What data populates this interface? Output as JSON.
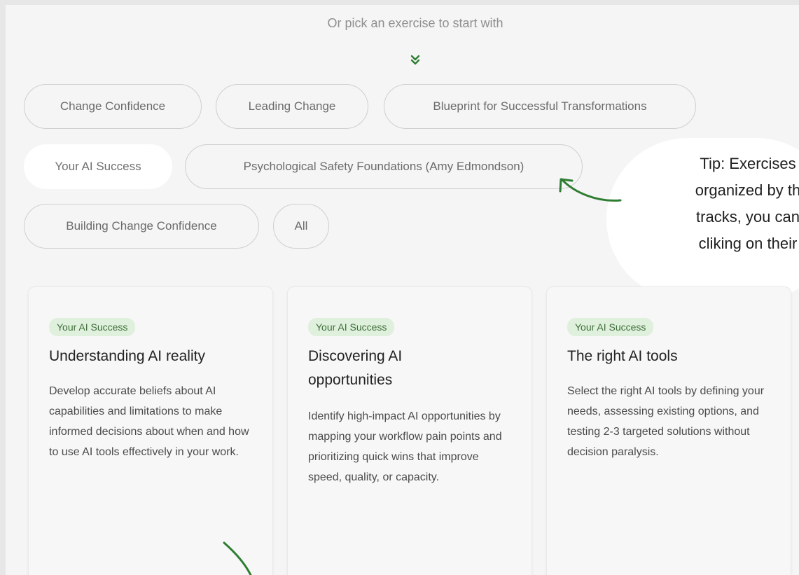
{
  "heading": "Or pick an exercise to start with",
  "filters": [
    {
      "label": "Change Confidence",
      "active": false
    },
    {
      "label": "Leading Change",
      "active": false
    },
    {
      "label": "Blueprint for Successful Transformations",
      "active": false
    },
    {
      "label": "Your AI Success",
      "active": true
    },
    {
      "label": "Psychological Safety Foundations (Amy Edmondson)",
      "active": false
    },
    {
      "label": "Building Change Confidence",
      "active": false
    },
    {
      "label": "All",
      "active": false
    }
  ],
  "cards": [
    {
      "badge": "Your AI Success",
      "title": "Understanding AI reality",
      "description": "Develop accurate beliefs about AI capabilities and limitations to make informed decisions about when and how to use AI tools effectively in your work."
    },
    {
      "badge": "Your AI Success",
      "title": "Discovering AI opportunities",
      "description": "Identify high-impact AI opportunities by mapping your workflow pain points and prioritizing quick wins that improve speed, quality, or capacity."
    },
    {
      "badge": "Your AI Success",
      "title": "The right AI tools",
      "description": "Select the right AI tools by defining your needs, assessing existing options, and testing 2-3 targeted solutions without decision paralysis."
    }
  ],
  "tip": {
    "text": "Tip: Exercises\norganized by th\ntracks, you can \ncliking on their"
  },
  "icons": {
    "chevron": "double-chevron-down-icon",
    "arrow": "curved-arrow-icon"
  },
  "colors": {
    "accent_green": "#2e7d32",
    "badge_bg": "#dff0dc",
    "badge_text": "#3f6e3a"
  }
}
